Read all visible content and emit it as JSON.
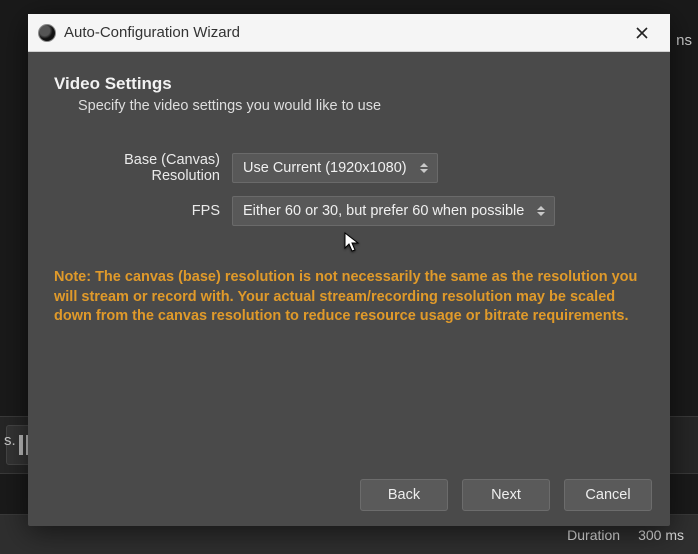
{
  "window": {
    "title": "Auto-Configuration Wizard"
  },
  "page": {
    "heading": "Video Settings",
    "subheading": "Specify the video settings you would like to use"
  },
  "form": {
    "resolution": {
      "label": "Base (Canvas) Resolution",
      "value": "Use Current (1920x1080)"
    },
    "fps": {
      "label": "FPS",
      "value": "Either 60 or 30, but prefer 60 when possible"
    }
  },
  "note": "Note: The canvas (base) resolution is not necessarily the same as the resolution you will stream or record with. Your actual stream/recording resolution may be scaled down from the canvas resolution to reduce resource usage or bitrate requirements.",
  "buttons": {
    "back": "Back",
    "next": "Next",
    "cancel": "Cancel"
  },
  "statusbar": {
    "duration_label": "Duration",
    "duration_value": "300 ms"
  }
}
